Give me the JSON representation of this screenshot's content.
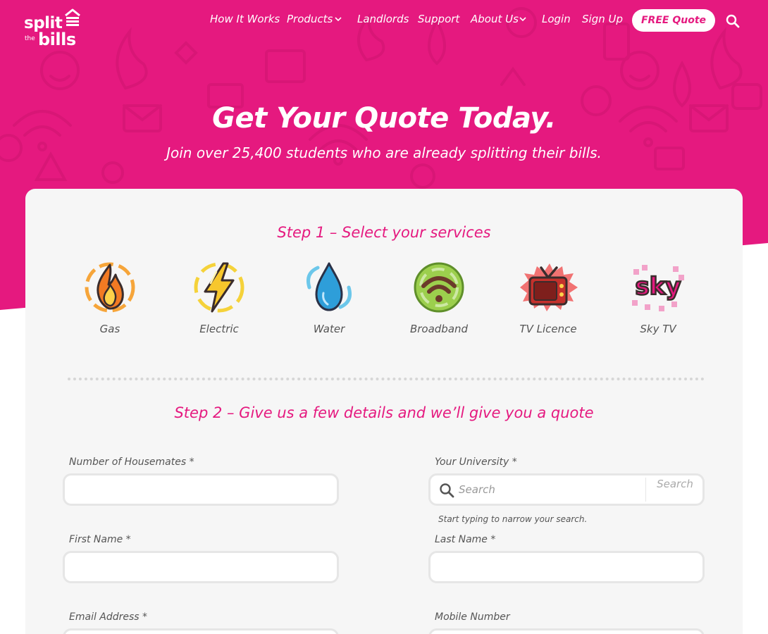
{
  "brand": {
    "logo_line1": "split",
    "logo_line2": "the",
    "logo_line3": "bills",
    "accent_color": "#e5197f"
  },
  "nav": {
    "items": [
      {
        "label": "How It Works",
        "has_dropdown": false
      },
      {
        "label": "Products",
        "has_dropdown": true
      },
      {
        "label": "Landlords",
        "has_dropdown": false
      },
      {
        "label": "Support",
        "has_dropdown": false
      },
      {
        "label": "About Us",
        "has_dropdown": true
      },
      {
        "label": "Login",
        "has_dropdown": false
      },
      {
        "label": "Sign Up",
        "has_dropdown": false
      }
    ],
    "cta_label": "FREE Quote",
    "search_icon": "search-icon"
  },
  "hero": {
    "title": "Get Your Quote Today.",
    "subtitle": "Join over 25,400 students who are already splitting their bills."
  },
  "step1": {
    "title": "Step 1 – Select your services",
    "services": [
      {
        "label": "Gas",
        "icon": "flame-icon"
      },
      {
        "label": "Electric",
        "icon": "lightning-icon"
      },
      {
        "label": "Water",
        "icon": "water-drop-icon"
      },
      {
        "label": "Broadband",
        "icon": "wifi-icon"
      },
      {
        "label": "TV Licence",
        "icon": "tv-icon"
      },
      {
        "label": "Sky TV",
        "icon": "sky-logo-icon",
        "logo_text": "sky"
      }
    ]
  },
  "step2": {
    "title": "Step 2 – Give us a few details and we’ll give you a quote",
    "fields": {
      "housemates": {
        "label": "Number of Housemates *",
        "value": ""
      },
      "university": {
        "label": "Your University *",
        "placeholder": "Search",
        "button_label": "Search",
        "hint": "Start typing to narrow your search."
      },
      "first_name": {
        "label": "First Name *",
        "value": ""
      },
      "last_name": {
        "label": "Last Name *",
        "value": ""
      },
      "email": {
        "label": "Email Address *",
        "value": ""
      },
      "mobile": {
        "label": "Mobile Number",
        "value": ""
      }
    }
  }
}
